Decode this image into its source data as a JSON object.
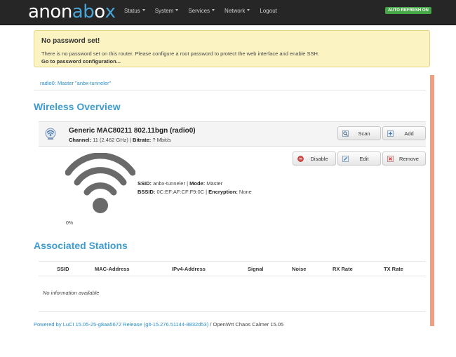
{
  "navbar": {
    "brand": {
      "part1": "anon",
      "part2": "ab",
      "part3": "x",
      "box": "o"
    },
    "items": [
      {
        "label": "Status",
        "dropdown": true
      },
      {
        "label": "System",
        "dropdown": true
      },
      {
        "label": "Services",
        "dropdown": true
      },
      {
        "label": "Network",
        "dropdown": true
      },
      {
        "label": "Logout",
        "dropdown": false
      }
    ],
    "auto_refresh": "AUTO REFRESH ON"
  },
  "alert": {
    "title": "No password set!",
    "text": "There is no password set on this router. Please configure a root password to protect the web interface and enable SSH.",
    "link": "Go to password configuration..."
  },
  "breadcrumb": "radio0: Master \"anbx-tunneler\"",
  "wireless_overview": {
    "title": "Wireless Overview",
    "device": {
      "name": "Generic MAC80211 802.11bgn (radio0)",
      "channel_label": "Channel:",
      "channel_value": "11 (2.462 GHz)",
      "bitrate_label": "Bitrate:",
      "bitrate_value": "? Mbit/s",
      "buttons": {
        "scan": "Scan",
        "add": "Add"
      }
    },
    "network": {
      "signal_percent": "0%",
      "ssid_label": "SSID:",
      "ssid_value": "anbx-tunneler",
      "mode_label": "Mode:",
      "mode_value": "Master",
      "bssid_label": "BSSID:",
      "bssid_value": "0C:EF:AF:CF:F9:0C",
      "encryption_label": "Encryption:",
      "encryption_value": "None",
      "buttons": {
        "disable": "Disable",
        "edit": "Edit",
        "remove": "Remove"
      }
    }
  },
  "associated_stations": {
    "title": "Associated Stations",
    "columns": [
      "SSID",
      "MAC-Address",
      "IPv4-Address",
      "Signal",
      "Noise",
      "RX Rate",
      "TX Rate"
    ],
    "empty_text": "No information available"
  },
  "footer": {
    "link_text": "Powered by LuCI 15.05-25-g8aa5672 Release (git-15.276.51144-8832d53)",
    "suffix": "/ OpenWrt Chaos Calmer 15.05"
  },
  "colors": {
    "accent": "#3d9cd2",
    "navbar_bg": "#262626",
    "alert_bg": "#fcf3c3",
    "auto_refresh_bg": "#46a546",
    "side_bar": "#f0a080"
  }
}
